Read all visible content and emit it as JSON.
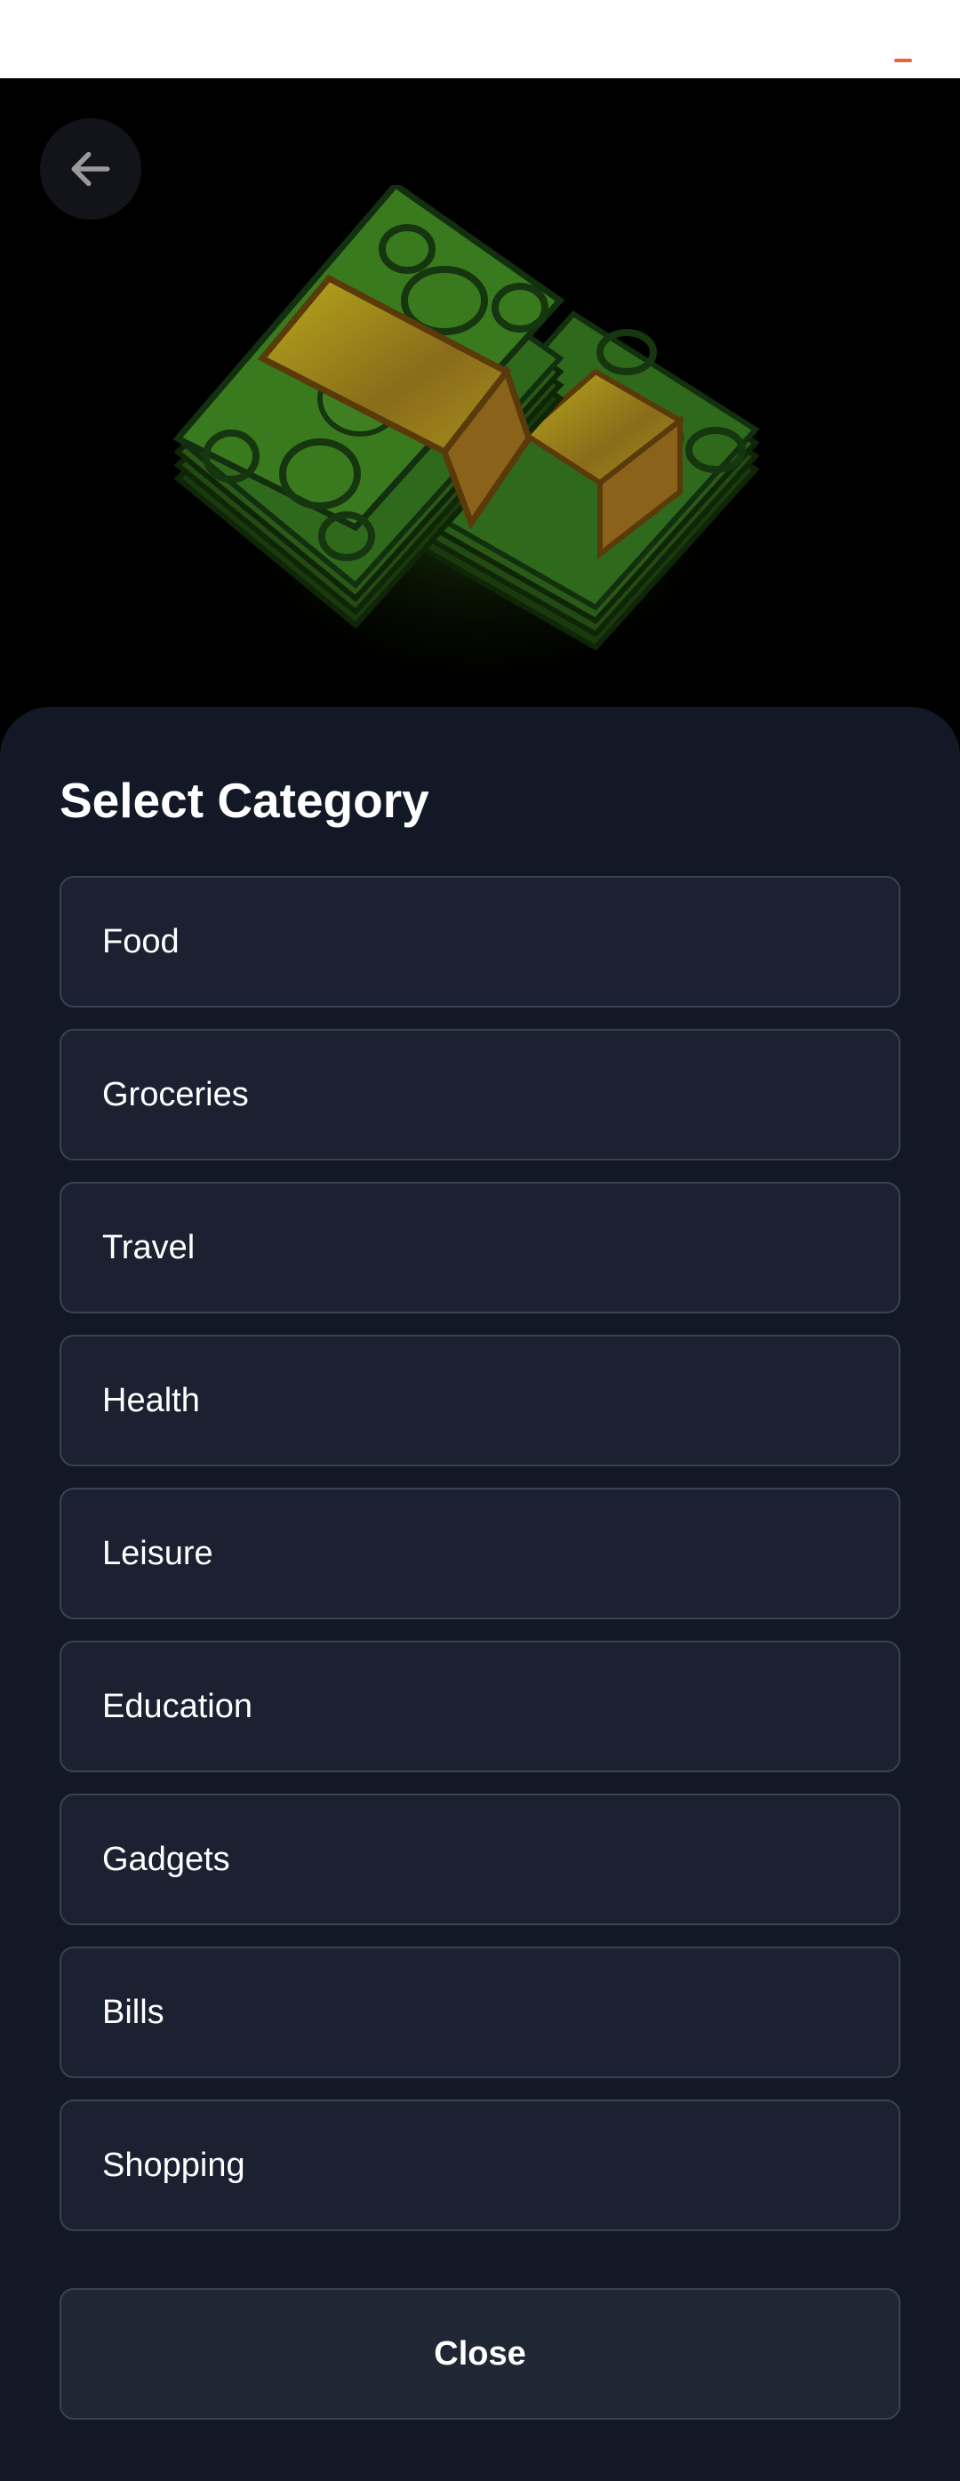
{
  "icons": {
    "back": "arrow-left-icon",
    "hero": "money-stack-icon"
  },
  "colors": {
    "sheet_background": "#121826",
    "item_background": "#1b2130",
    "item_border": "#3a4252",
    "money_green": "#2f6a1c",
    "band_gold": "#a89a18"
  },
  "sheet": {
    "title": "Select Category",
    "categories": [
      "Food",
      "Groceries",
      "Travel",
      "Health",
      "Leisure",
      "Education",
      "Gadgets",
      "Bills",
      "Shopping"
    ],
    "close_label": "Close"
  }
}
